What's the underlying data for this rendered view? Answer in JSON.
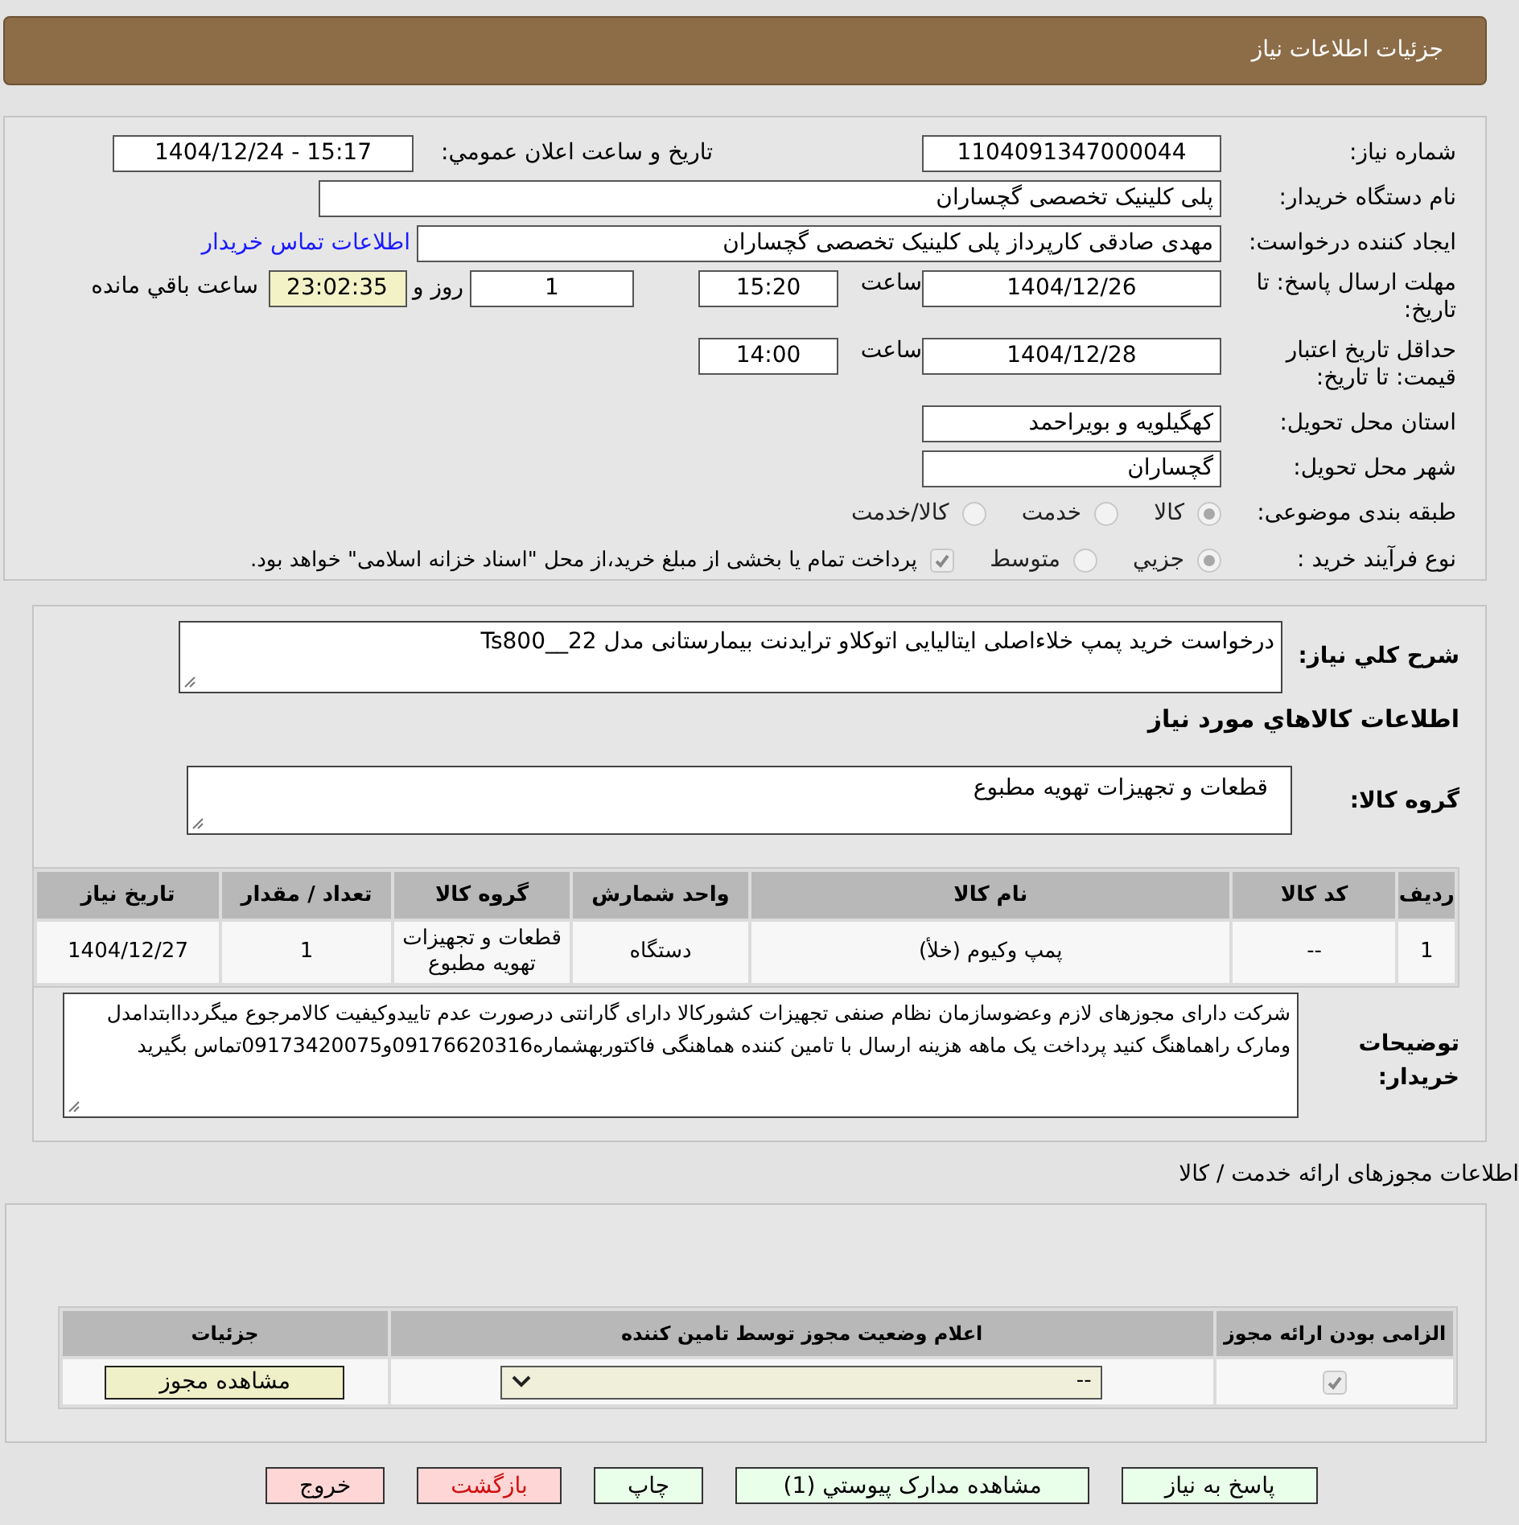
{
  "header": {
    "title": "جزئیات اطلاعات نیاز"
  },
  "need_number": {
    "label": "شماره نیاز:",
    "value": "1104091347000044"
  },
  "announce": {
    "label": "تاریخ و ساعت اعلان عمومي:",
    "value": "1404/12/24 - 15:17"
  },
  "buyer_org": {
    "label": "نام دستگاه خریدار:",
    "value": "پلی کلینیک تخصصی گچساران"
  },
  "creator": {
    "label": "ایجاد کننده درخواست:",
    "value": "مهدی صادقی کارپرداز پلی کلینیک تخصصی گچساران",
    "link": "اطلاعات تماس خریدار"
  },
  "response_deadline": {
    "label": "مهلت ارسال پاسخ: تا تاریخ:",
    "date": "1404/12/26",
    "time_label": "ساعت",
    "time": "15:20",
    "days": "1",
    "days_label": "روز و",
    "remaining": "23:02:35",
    "remaining_label": "ساعت باقي مانده"
  },
  "price_validity": {
    "label": "حداقل تاریخ اعتبار قیمت: تا تاریخ:",
    "date": "1404/12/28",
    "time_label": "ساعت",
    "time": "14:00"
  },
  "province": {
    "label": "استان محل تحویل:",
    "value": "کهگیلویه و بویراحمد"
  },
  "city": {
    "label": "شهر محل تحویل:",
    "value": "گچساران"
  },
  "category": {
    "label": "طبقه بندی موضوعی:",
    "options": [
      {
        "label": "کالا",
        "selected": true
      },
      {
        "label": "خدمت",
        "selected": false
      },
      {
        "label": "کالا/خدمت",
        "selected": false
      }
    ]
  },
  "process": {
    "label": "نوع فرآیند خرید :",
    "options": [
      {
        "label": "جزيي",
        "selected": true
      },
      {
        "label": "متوسط",
        "selected": false
      }
    ],
    "payment_note": {
      "checked": true,
      "text": "پرداخت تمام یا بخشی از مبلغ خرید،از محل \"اسناد خزانه اسلامی\" خواهد بود."
    }
  },
  "description": {
    "label": "شرح کلي نیاز:",
    "value": "درخواست خرید پمپ خلاءاصلی ایتالیایی اتوکلاو ترایدنت بیمارستانی مدل 22__Ts800"
  },
  "goods_section_title": "اطلاعات کالاهاي مورد نیاز",
  "goods_group": {
    "label": "گروه کالا:",
    "value": "قطعات و تجهیزات تهویه مطبوع"
  },
  "goods_table": {
    "columns": [
      "ردیف",
      "کد کالا",
      "نام کالا",
      "واحد شمارش",
      "گروه کالا",
      "تعداد / مقدار",
      "تاریخ نیاز"
    ],
    "rows": [
      [
        "1",
        "--",
        "پمپ وکیوم (خلأ)",
        "دستگاه",
        "قطعات و تجهیزات تهویه مطبوع",
        "1",
        "1404/12/27"
      ]
    ]
  },
  "buyer_notes": {
    "label": "توضیحات خریدار:",
    "value": "شرکت دارای مجوزهای لازم وعضوسازمان نظام صنفی تجهیزات کشورکالا دارای گارانتی درصورت عدم تاییدوکیفیت کالامرجوع میگردداابتدامدل ومارک راهماهنگ کنید پرداخت یک ماهه هزینه ارسال با تامین کننده هماهنگی فاکتوربهشماره09176620316و09173420075تماس بگیرید"
  },
  "licenses": {
    "title": "اطلاعات مجوزهای ارائه خدمت / کالا",
    "columns": [
      "الزامی بودن ارائه مجوز",
      "اعلام وضعیت مجوز توسط تامین کننده",
      "جزئیات"
    ],
    "rows": [
      {
        "required": true,
        "status": "--",
        "action": "مشاهده مجوز"
      }
    ]
  },
  "buttons": [
    {
      "label": "پاسخ به نیاز",
      "kind": "normal"
    },
    {
      "label": "مشاهده مدارک پیوستي (1)",
      "kind": "normal"
    },
    {
      "label": "چاپ",
      "kind": "normal"
    },
    {
      "label": "بازگشت",
      "kind": "back"
    },
    {
      "label": "خروج",
      "kind": "exit"
    }
  ]
}
